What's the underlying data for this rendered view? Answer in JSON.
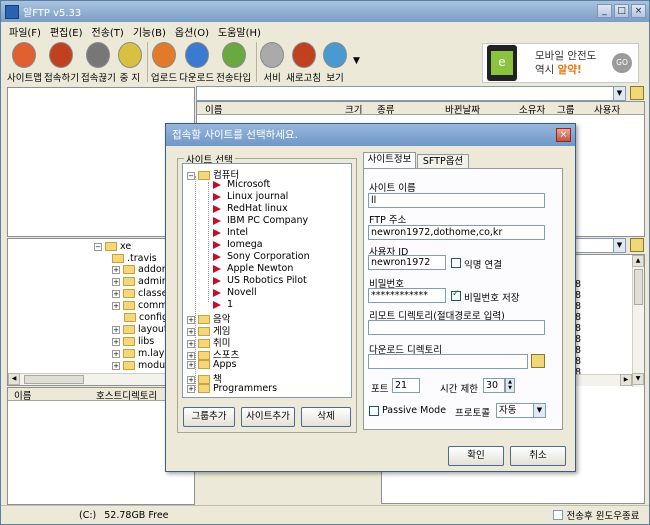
{
  "window": {
    "title": "알FTP  v5.33"
  },
  "menu": [
    "파일(F)",
    "편집(E)",
    "전송(T)",
    "기능(B)",
    "옵션(O)",
    "도움말(H)"
  ],
  "toolbar": [
    {
      "label": "사이트맵",
      "icon": "sitemap-icon",
      "color": "#e06030"
    },
    {
      "label": "접속하기",
      "icon": "connect-icon",
      "color": "#c04020"
    },
    {
      "label": "접속끊기",
      "icon": "disconnect-icon",
      "color": "#777777"
    },
    {
      "label": "중 지",
      "icon": "stop-icon",
      "color": "#d8c040"
    },
    {
      "label": "업로드",
      "icon": "upload-icon",
      "color": "#e27a2a"
    },
    {
      "label": "다운로드",
      "icon": "download-icon",
      "color": "#3a7ad0"
    },
    {
      "label": "전송타입",
      "icon": "transfer-type-icon",
      "color": "#6aa840"
    },
    {
      "label": "서비",
      "icon": "server-icon",
      "color": "#aaaaaa"
    },
    {
      "label": "새로고침",
      "icon": "refresh-icon",
      "color": "#c04020"
    },
    {
      "label": "보기",
      "icon": "view-icon",
      "color": "#4a9ad0"
    }
  ],
  "ad": {
    "line1": "모바일 안전도",
    "line2_prefix": "역시 ",
    "line2_highlight": "알약!",
    "go": "GO"
  },
  "remote_header": {
    "name": "이름",
    "size": "크기",
    "type": "종류",
    "date": "바뀐날짜",
    "owner": "소유자",
    "group": "그룹",
    "user": "사용자"
  },
  "local_tree": {
    "root": "xe",
    "items": [
      {
        "name": ".travis",
        "expand": false
      },
      {
        "name": "addons",
        "expand": true
      },
      {
        "name": "admin",
        "expand": true
      },
      {
        "name": "classe",
        "expand": true
      },
      {
        "name": "commo",
        "expand": true
      },
      {
        "name": "config",
        "expand": false
      },
      {
        "name": "layouts",
        "expand": true
      },
      {
        "name": "libs",
        "expand": true
      },
      {
        "name": "m.layo",
        "expand": true
      },
      {
        "name": "module",
        "expand": true
      }
    ]
  },
  "local_header": {
    "name": "이름",
    "host_dir": "호스트디렉토리"
  },
  "right_numbers": [
    "8",
    "8",
    "8",
    "8",
    "8",
    "8",
    "8",
    "8",
    "8"
  ],
  "status": {
    "drive": "(C:)",
    "free": "52.78GB Free",
    "shutdown": "전송후 윈도우종료"
  },
  "dialog": {
    "title": "접속할 사이트를 선택하세요.",
    "group_label": "사이트 선택",
    "root_folder": "컴퓨터",
    "sites": [
      "Microsoft",
      "Linux journal",
      "RedHat linux",
      "IBM PC Company",
      "Intel",
      "Iomega",
      "Sony Corporation",
      "Apple Newton",
      "US Robotics Pilot",
      "Novell",
      "1"
    ],
    "folders": [
      "음악",
      "게임",
      "취미",
      "스포츠",
      "Apps",
      "책",
      "Programmers"
    ],
    "buttons": {
      "add_group": "그룹추가",
      "add_site": "사이트추가",
      "delete": "삭제"
    },
    "tabs": [
      "사이트정보",
      "SFTP옵션"
    ],
    "form": {
      "site_name_label": "사이트 이름",
      "site_name": "ll",
      "ftp_address_label": "FTP 주소",
      "ftp_address": "newron1972,dothome,co,kr",
      "user_id_label": "사용자 ID",
      "user_id": "newron1972",
      "anonymous_label": "익명 연결",
      "anonymous_checked": false,
      "password_label": "비밀번호",
      "password": "************",
      "save_password_label": "비밀번호 저장",
      "save_password_checked": true,
      "remote_dir_label": "리모트 디렉토리(절대경로로 입력)",
      "remote_dir": "",
      "download_dir_label": "다운로드 디렉토리",
      "download_dir": "",
      "port_label": "포트",
      "port": "21",
      "timeout_label": "시간 제한",
      "timeout": "30",
      "passive_label": "Passive Mode",
      "passive_checked": false,
      "protocol_label": "프로토콜",
      "protocol": "자동"
    },
    "ok": "확인",
    "cancel": "취소"
  }
}
